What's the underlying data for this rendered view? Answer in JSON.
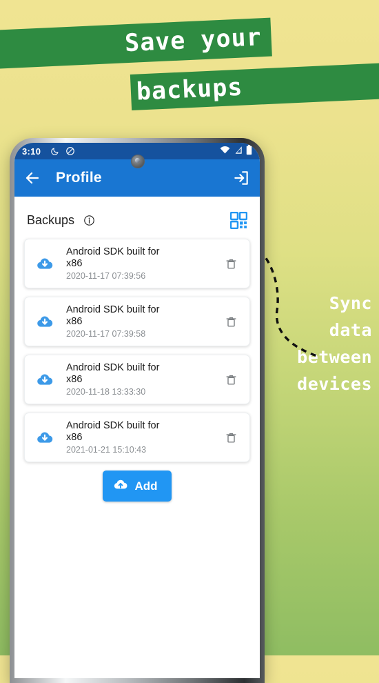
{
  "promo": {
    "line1": "Save your",
    "line2": "backups",
    "annotation_lines": [
      "Sync",
      "data",
      "between",
      "devices"
    ],
    "banner_color": "#2e8b41",
    "bg_top_color": "#f0e492",
    "bg_bottom_color": "#8fbd62"
  },
  "phone": {
    "status_bar": {
      "time": "3:10",
      "icons": [
        "moon-icon",
        "do-not-disturb-icon"
      ],
      "right_icons": [
        "wifi-icon",
        "cellular-signal-icon",
        "battery-icon"
      ],
      "bg_color": "#15529e"
    },
    "app_bar": {
      "back_icon": "arrow-left-icon",
      "title": "Profile",
      "action_icon": "logout-icon",
      "bg_color": "#1976d2"
    },
    "section": {
      "label": "Backups",
      "info_icon": "info-icon",
      "qr_icon": "qr-code-icon",
      "qr_color": "#2196f3"
    },
    "backups": [
      {
        "icon": "cloud-download-icon",
        "name": "Android SDK built for x86",
        "timestamp": "2020-11-17 07:39:56",
        "delete_icon": "trash-icon"
      },
      {
        "icon": "cloud-download-icon",
        "name": "Android SDK built for x86",
        "timestamp": "2020-11-17 07:39:58",
        "delete_icon": "trash-icon"
      },
      {
        "icon": "cloud-download-icon",
        "name": "Android SDK built for x86",
        "timestamp": "2020-11-18 13:33:30",
        "delete_icon": "trash-icon"
      },
      {
        "icon": "cloud-download-icon",
        "name": "Android SDK built for x86",
        "timestamp": "2021-01-21 15:10:43",
        "delete_icon": "trash-icon"
      }
    ],
    "add_button": {
      "label": "Add",
      "icon": "cloud-upload-icon",
      "color": "#2196f3"
    }
  }
}
